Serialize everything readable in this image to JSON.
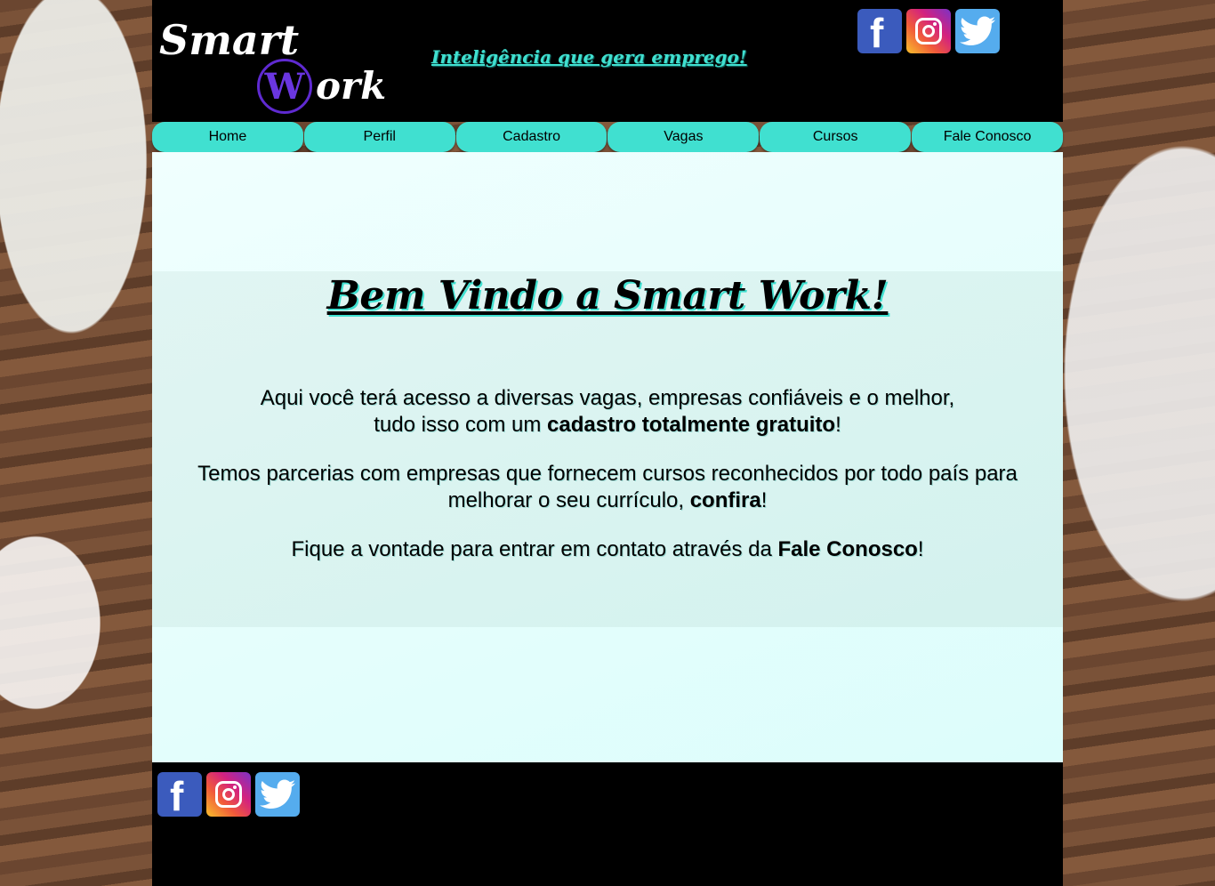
{
  "header": {
    "logo_top": "Smart",
    "logo_letter": "W",
    "logo_bottom": "ork",
    "tagline": "Inteligência que gera emprego!"
  },
  "social": {
    "facebook": "f",
    "icons": [
      "facebook-icon",
      "instagram-icon",
      "twitter-icon"
    ]
  },
  "nav": {
    "items": [
      "Home",
      "Perfil",
      "Cadastro",
      "Vagas",
      "Cursos",
      "Fale Conosco"
    ]
  },
  "welcome": {
    "title": "Bem Vindo a Smart Work!",
    "p1_line1": "Aqui você terá acesso a diversas vagas, empresas confiáveis e o melhor,",
    "p1_line2_prefix": "tudo isso com um ",
    "p1_line2_bold": "cadastro totalmente gratuito",
    "p1_line2_suffix": "!",
    "p2_text": "Temos parcerias com empresas que fornecem cursos reconhecidos por todo país para melhorar o seu currículo, ",
    "p2_bold": "confira",
    "p2_suffix": "!",
    "p3_text": "Fique a vontade para entrar em contato através da ",
    "p3_bold": "Fale Conosco",
    "p3_suffix": "!"
  },
  "colors": {
    "accent": "#40e0d0",
    "header_bg": "#000000",
    "content_bg": "#e6fffd"
  }
}
